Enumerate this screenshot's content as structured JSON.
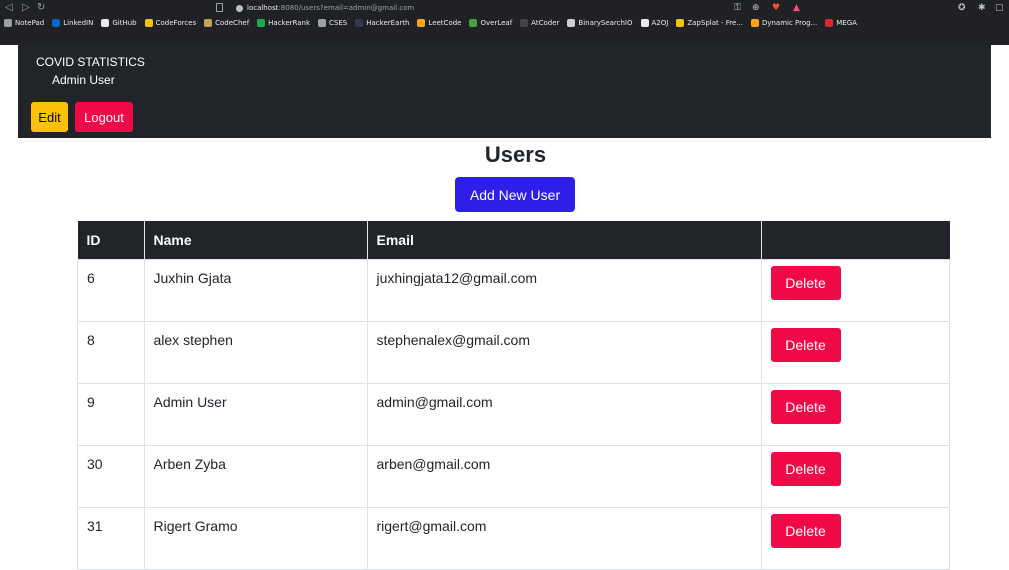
{
  "browser": {
    "address_host": "localhost",
    "address_path": ":8080/users?email=admin@gmail.com",
    "bookmarks": [
      {
        "label": "NotePad",
        "icon": "globe-icon",
        "color": "#9aa0a6"
      },
      {
        "label": "LinkedIN",
        "icon": "linkedin-icon",
        "color": "#0a66c2"
      },
      {
        "label": "GitHub",
        "icon": "github-icon",
        "color": "#e8eaed"
      },
      {
        "label": "CodeForces",
        "icon": "codeforces-icon",
        "color": "#f4c20d"
      },
      {
        "label": "CodeChef",
        "icon": "codechef-icon",
        "color": "#c6a15b"
      },
      {
        "label": "HackerRank",
        "icon": "hackerrank-icon",
        "color": "#1ba94c"
      },
      {
        "label": "CSES",
        "icon": "globe-icon",
        "color": "#9aa0a6"
      },
      {
        "label": "HackerEarth",
        "icon": "hackerearth-icon",
        "color": "#323754"
      },
      {
        "label": "LeetCode",
        "icon": "leetcode-icon",
        "color": "#ffa116"
      },
      {
        "label": "OverLeaf",
        "icon": "overleaf-icon",
        "color": "#47a141"
      },
      {
        "label": "AtCoder",
        "icon": "atcoder-icon",
        "color": "#444"
      },
      {
        "label": "BinarySearchIO",
        "icon": "binarysearch-icon",
        "color": "#cfcfcf"
      },
      {
        "label": "A2OJ",
        "icon": "a2oj-icon",
        "color": "#e8eaed"
      },
      {
        "label": "ZapSplat - Fre...",
        "icon": "zapsplat-icon",
        "color": "#f4c20d"
      },
      {
        "label": "Dynamic Prog...",
        "icon": "leetcode-icon",
        "color": "#ffa116"
      },
      {
        "label": "MEGA",
        "icon": "mega-icon",
        "color": "#d9272e"
      }
    ]
  },
  "navbar": {
    "brand": "COVID STATISTICS",
    "user_name": "Admin User",
    "edit_label": "Edit",
    "logout_label": "Logout"
  },
  "page": {
    "title": "Users",
    "add_button": "Add New User"
  },
  "table": {
    "headers": [
      "ID",
      "Name",
      "Email",
      ""
    ],
    "delete_label": "Delete",
    "rows": [
      {
        "id": "6",
        "name": "Juxhin Gjata",
        "email": "juxhingjata12@gmail.com"
      },
      {
        "id": "8",
        "name": "alex stephen",
        "email": "stephenalex@gmail.com"
      },
      {
        "id": "9",
        "name": "Admin User",
        "email": "admin@gmail.com"
      },
      {
        "id": "30",
        "name": "Arben Zyba",
        "email": "arben@gmail.com"
      },
      {
        "id": "31",
        "name": "Rigert Gramo",
        "email": "rigert@gmail.com"
      }
    ]
  }
}
